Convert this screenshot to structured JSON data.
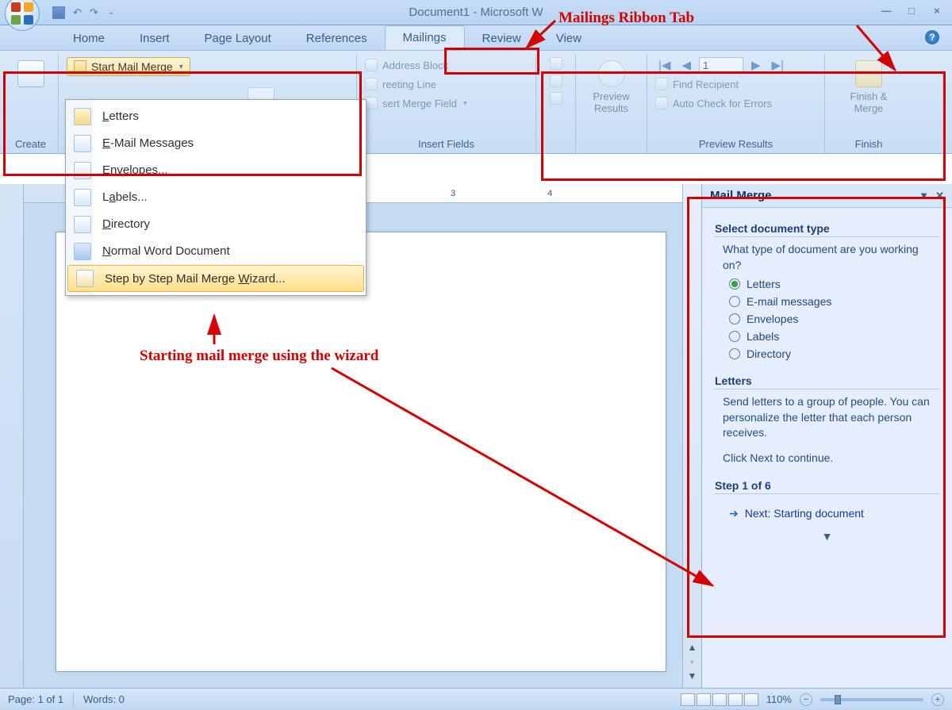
{
  "window": {
    "title": "Document1 - Microsoft W"
  },
  "tabs": {
    "home": "Home",
    "insert": "Insert",
    "page_layout": "Page Layout",
    "references": "References",
    "mailings": "Mailings",
    "review": "Review",
    "view": "View"
  },
  "ribbon": {
    "create": "Create",
    "start_mail_merge": "Start Mail Merge",
    "address_block": "Address Block",
    "greeting_line": "reeting Line",
    "insert_merge_field": "sert Merge Field",
    "insert_fields_group": "Insert Fields",
    "preview_results": "Preview\nResults",
    "find_recipient": "Find Recipient",
    "auto_check": "Auto Check for Errors",
    "preview_results_group": "Preview Results",
    "finish_merge": "Finish &\nMerge",
    "finish_group": "Finish",
    "record_value": "1"
  },
  "dropdown": {
    "letters": "Letters",
    "email": "E-Mail Messages",
    "envelopes": "Envelopes...",
    "labels": "Labels...",
    "directory": "Directory",
    "normal": "Normal Word Document",
    "wizard": "Step by Step Mail Merge Wizard..."
  },
  "taskpane": {
    "title": "Mail Merge",
    "section1": "Select document type",
    "question": "What type of document are you working on?",
    "opt_letters": "Letters",
    "opt_email": "E-mail messages",
    "opt_envelopes": "Envelopes",
    "opt_labels": "Labels",
    "opt_directory": "Directory",
    "section2": "Letters",
    "desc": "Send letters to a group of people. You can personalize the letter that each person receives.",
    "click_next": "Click Next to continue.",
    "step": "Step 1 of 6",
    "next": "Next: Starting document"
  },
  "status": {
    "page": "Page: 1 of 1",
    "words": "Words: 0",
    "zoom": "110%"
  },
  "ruler": {
    "n3": "3",
    "n4": "4"
  },
  "annotations": {
    "ribbon_tab": "Mailings Ribbon Tab",
    "wizard": "Starting mail merge using the wizard"
  }
}
